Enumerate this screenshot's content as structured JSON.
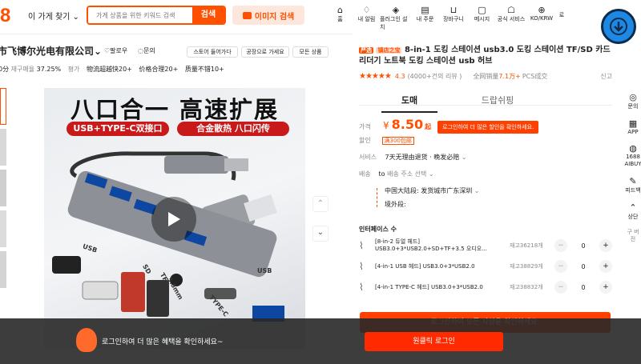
{
  "header": {
    "logo": "8",
    "store_search_dropdown": "이 가게 찾기",
    "search_placeholder": "가게 상품을 위한 키워드 검색",
    "search_button": "검색",
    "image_search_button": "이미지 검색",
    "nav": [
      {
        "label": "홈",
        "icon": "home-icon"
      },
      {
        "label": "내 알림",
        "icon": "bell-icon"
      },
      {
        "label": "플러그인 설치",
        "icon": "plugin-icon"
      },
      {
        "label": "내 주문",
        "icon": "orders-icon"
      },
      {
        "label": "장바구니",
        "icon": "cart-icon"
      },
      {
        "label": "메시지",
        "icon": "message-icon"
      },
      {
        "label": "공식 서비스",
        "icon": "service-icon"
      },
      {
        "label": "KO/KRW",
        "icon": "globe-icon"
      }
    ],
    "nav_extra": "로"
  },
  "store": {
    "name": "市飞博尔光电有限公司",
    "follow": "팔로우",
    "inquiry": "문의",
    "score_prefix": "0分",
    "repurchase_label": "재구매율",
    "repurchase_value": "37.25%",
    "rating_label": "평가",
    "tags": [
      "物流超越快20+",
      "价格合理20+",
      "质量不错10+"
    ],
    "buttons": [
      "스토어 들어가다",
      "공장으로 가세요",
      "모든 상품"
    ]
  },
  "gallery": {
    "banner_line1": "八口合一 高速扩展",
    "tag_left": "USB+TYPE-C双接口",
    "tag_right": "合金散热 八口闪传",
    "labels": [
      "USB",
      "SD",
      "TF",
      "3.5mm",
      "TYPE-C",
      "USB"
    ]
  },
  "product": {
    "badge1": "严选",
    "badge2": "镇店之宝",
    "title": "8-in-1 도킹 스테이션 usb3.0 도킹 스테이션 TF/SD 카드 리더기 노트북 도킹 스테이션 usb 허브",
    "rating": "4.3",
    "reviews": "(4000+건의 리뷰 )",
    "sold_label": "全网销量",
    "sold_value": "7.1万+",
    "sold_suffix": "PCS成交",
    "report": "신고",
    "tabs": [
      "도매",
      "드랍쉬핑"
    ],
    "price_label": "가격",
    "price_currency": "¥",
    "price_value": "8.50",
    "price_unit": "起",
    "price_login_btn": "로그인하여 더 많은 할인을 확인하세요.",
    "discount_label": "할인",
    "discount_value": "满300包邮",
    "service_label": "서비스",
    "service_value": "7天无理由退货 · 晚发必赔",
    "delivery_label": "배송",
    "delivery_to": "to",
    "delivery_select": "배송 주소 선택",
    "origin_mainland": "中国大陆段: 发货城市广东深圳",
    "origin_overseas": "境外段:",
    "interface_label": "인터페이스 수",
    "variants": [
      {
        "name": "[8-in-2 듀얼 헤드] USB3.0+3*USB2.0+SD+TF+3.5 오디오...",
        "stock": "재고36218개",
        "qty": "0"
      },
      {
        "name": "[4-in-1 USB 헤드] USB3.0+3*USB2.0",
        "stock": "재고38829개",
        "qty": "0"
      },
      {
        "name": "[4-in-1 TYPE-C 헤드] USB3.0+3*USB2.0",
        "stock": "재고38832개",
        "qty": "0"
      }
    ],
    "login_all_btn": "로그인하여 모든 사양을 확인하세요."
  },
  "sidebar": [
    {
      "label": "문의",
      "icon": "chat-icon"
    },
    {
      "label": "APP",
      "icon": "qr-icon"
    },
    {
      "label": "1688 AIBUY",
      "icon": "aibuy-icon"
    },
    {
      "label": "피드백",
      "icon": "feedback-icon"
    },
    {
      "label": "상단",
      "icon": "top-icon"
    },
    {
      "label": "구 버전",
      "icon": "old-version-icon"
    }
  ],
  "banner": {
    "text": "로그인하여 더 많은 혜택을 확인하세요~",
    "button": "원클릭 로그인"
  },
  "colors": {
    "accent": "#ff5000",
    "banner_bg": "#3d3d3d",
    "download_blue": "#1e88e5"
  }
}
